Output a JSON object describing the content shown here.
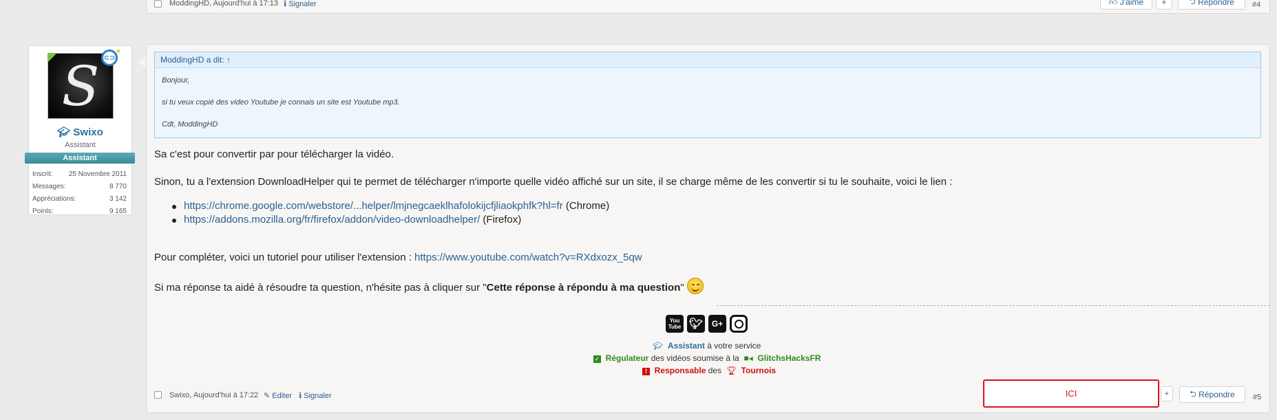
{
  "top_post": {
    "author_meta": "ModdingHD, Aujourd'hui à 17:13",
    "report_label": "Signaler",
    "like_label": "J'aime",
    "plus_label": "+",
    "reply_label": "Répondre",
    "post_number": "#4"
  },
  "user": {
    "avatar_letter": "S",
    "name": "Swixo",
    "title": "Assistant",
    "banner": "Assistant",
    "stats": [
      {
        "label": "Inscrit:",
        "value": "25 Novembre 2011"
      },
      {
        "label": "Messages:",
        "value": "8 770"
      },
      {
        "label": "Appréciations:",
        "value": "3 142"
      },
      {
        "label": "Points:",
        "value": "9 165"
      }
    ]
  },
  "quote": {
    "header": "ModdingHD a dit: ↑",
    "lines": [
      "Bonjour,",
      "si tu veux copié des video Youtube je connais un site est Youtube mp3.",
      "Cdt, ModdingHD"
    ]
  },
  "message": {
    "p1": "Sa c'est pour convertir par pour télécharger la vidéo.",
    "p2": "Sinon, tu a l'extension DownloadHelper qui te permet de télécharger n'importe quelle vidéo affiché sur un site, il se charge même de les convertir si tu le souhaite, voici le lien :",
    "links": [
      {
        "url": "https://chrome.google.com/webstore/...helper/lmjnegcaeklhafolokijcfjliaokphfk?hl=fr",
        "suffix": " (Chrome)"
      },
      {
        "url": "https://addons.mozilla.org/fr/firefox/addon/video-downloadhelper/",
        "suffix": " (Firefox)"
      }
    ],
    "p3_prefix": "Pour compléter, voici un tutoriel pour utiliser l'extension : ",
    "p3_link": "https://www.youtube.com/watch?v=RXdxozx_5qw",
    "p4_prefix": "Si ma réponse ta aidé à résoudre ta question, n'hésite pas à cliquer sur \"",
    "p4_bold": "Cette réponse à répondu à ma question",
    "p4_suffix": "\""
  },
  "signature": {
    "icons": [
      "You Tube",
      "twitter-icon",
      "G+",
      "instagram-icon"
    ],
    "line1_bold": "Assistant",
    "line1_rest": " à votre service",
    "line2_bold": "Régulateur",
    "line2_mid": " des vidéos soumise à la ",
    "line2_tag": "GlitchsHacksFR",
    "line3_bold": "Responsable",
    "line3_mid": " des ",
    "line3_tag": "Tournois"
  },
  "footer": {
    "author_meta": "Swixo, Aujourd'hui à 17:22",
    "edit_label": "Editer",
    "report_label": "Signaler",
    "ici_label": "ICI",
    "plus_label": "+",
    "reply_label": "Répondre",
    "post_number": "#5"
  },
  "colors": {
    "accent_blue": "#2b5f93",
    "green": "#2e8b1f",
    "red": "#cc1111",
    "banner_teal": "#3c8c98"
  }
}
